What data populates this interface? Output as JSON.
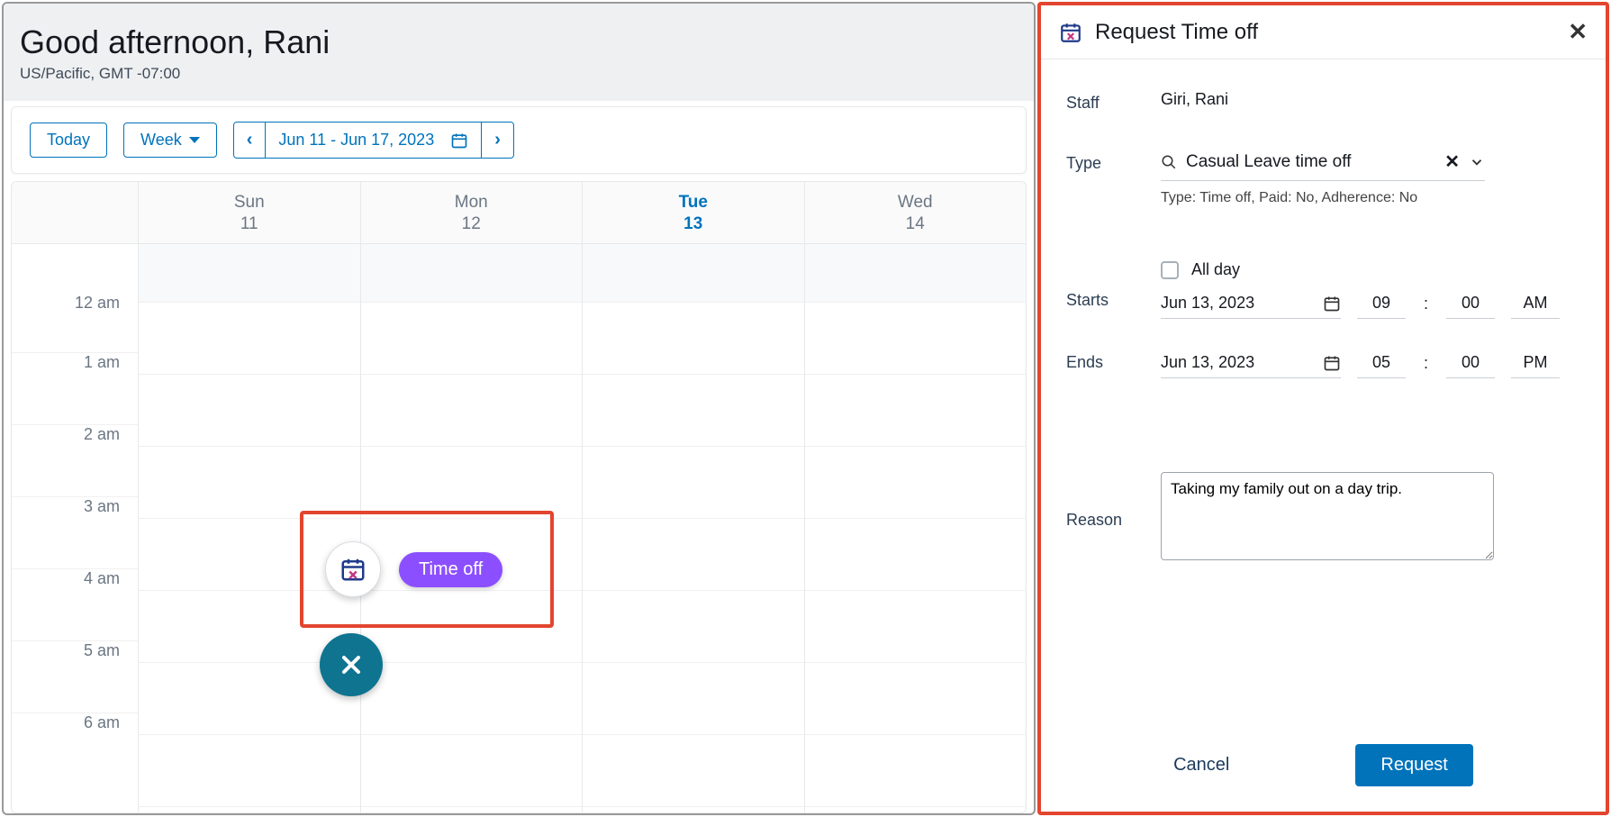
{
  "header": {
    "greeting": "Good afternoon, Rani",
    "timezone": "US/Pacific, GMT -07:00"
  },
  "toolbar": {
    "today_label": "Today",
    "view_label": "Week",
    "date_range": "Jun 11 - Jun 17, 2023"
  },
  "days": [
    {
      "name": "Sun",
      "num": "11",
      "today": false
    },
    {
      "name": "Mon",
      "num": "12",
      "today": false
    },
    {
      "name": "Tue",
      "num": "13",
      "today": true
    },
    {
      "name": "Wed",
      "num": "14",
      "today": false
    }
  ],
  "hours": [
    "12 am",
    "1 am",
    "2 am",
    "3 am",
    "4 am",
    "5 am",
    "6 am"
  ],
  "fab": {
    "timeoff_label": "Time off"
  },
  "panel": {
    "title": "Request Time off",
    "labels": {
      "staff": "Staff",
      "type": "Type",
      "starts": "Starts",
      "ends": "Ends",
      "reason": "Reason",
      "allday": "All day"
    },
    "staff_value": "Giri, Rani",
    "type_value": "Casual Leave time off",
    "type_meta": "Type: Time off, Paid: No, Adherence: No",
    "starts": {
      "date": "Jun 13, 2023",
      "hour": "09",
      "minute": "00",
      "ampm": "AM"
    },
    "ends": {
      "date": "Jun 13, 2023",
      "hour": "05",
      "minute": "00",
      "ampm": "PM"
    },
    "reason_value": "Taking my family out on a day trip.",
    "footer": {
      "cancel": "Cancel",
      "request": "Request"
    }
  }
}
